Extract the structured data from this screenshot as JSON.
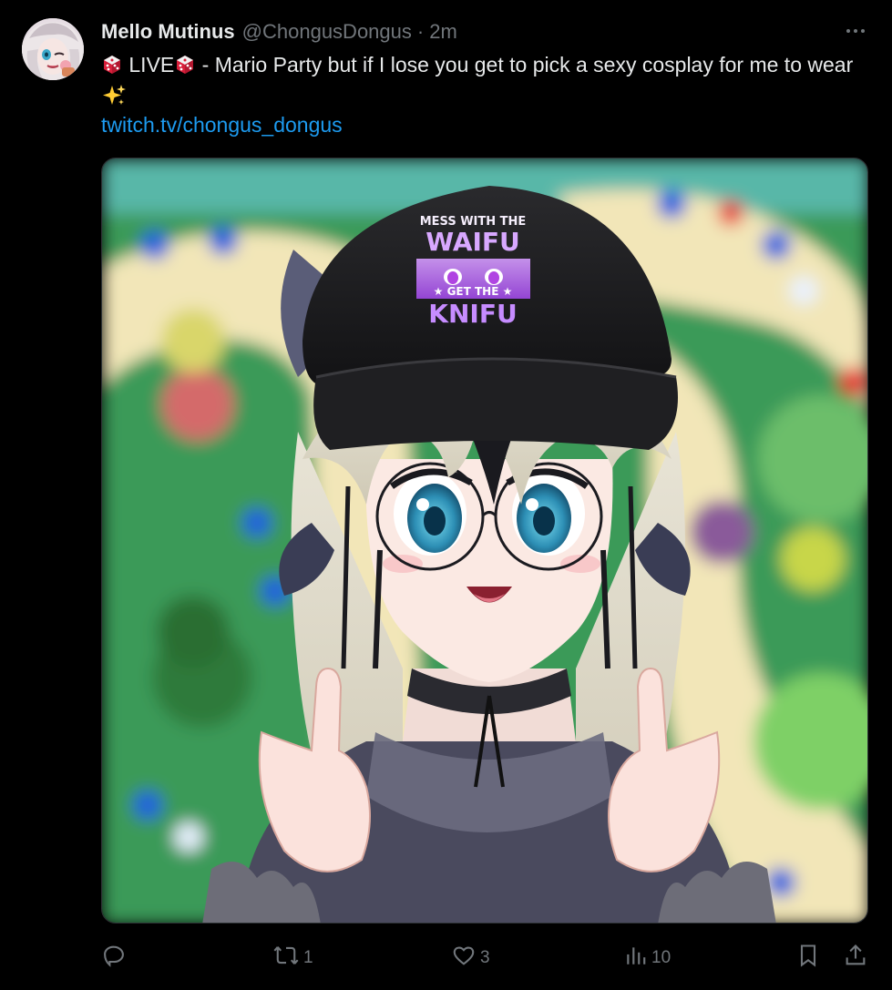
{
  "post": {
    "author": {
      "display_name": "Mello Mutinus",
      "handle": "@ChongusDongus",
      "separator": "·",
      "time": "2m",
      "avatar_icon": "avatar-image"
    },
    "text_before_emoji": "",
    "text_live": " LIVE",
    "text_main": " - Mario Party but if I lose you get to pick a sexy cosplay for me to wear ",
    "link": "twitch.tv/chongus_dongus",
    "image": {
      "cap_text_line1": "MESS WITH THE",
      "cap_text_line2": "WAIFU",
      "cap_text_line3": "★ GET THE ★",
      "cap_text_line4": "KNIFU"
    }
  },
  "actions": {
    "reply_icon": "reply-icon",
    "repost_icon": "repost-icon",
    "repost_count": "1",
    "like_icon": "heart-icon",
    "like_count": "3",
    "views_icon": "views-icon",
    "views_count": "10",
    "bookmark_icon": "bookmark-icon",
    "share_icon": "share-icon"
  },
  "colors": {
    "background": "#000000",
    "text": "#e7e9ea",
    "muted": "#71767b",
    "link": "#1d9bf0",
    "dice_red": "#d81e3a",
    "sparkle": "#ffcc33"
  }
}
